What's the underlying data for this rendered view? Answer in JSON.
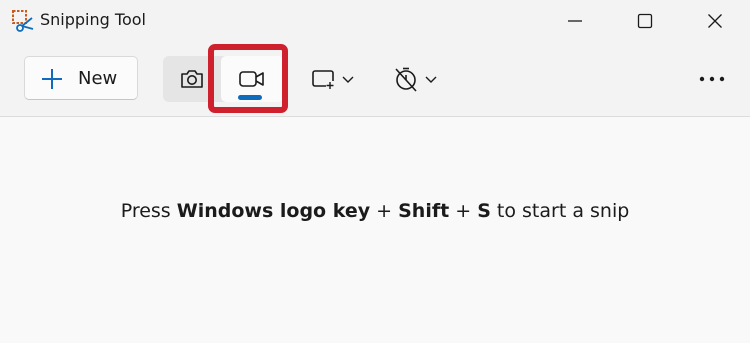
{
  "window": {
    "title": "Snipping Tool",
    "app_icon": "snipping-tool-icon",
    "controls": {
      "minimize_icon": "minimize-icon",
      "maximize_icon": "maximize-icon",
      "close_icon": "close-icon"
    }
  },
  "toolbar": {
    "new_label": "New",
    "new_icon": "plus-icon",
    "modes": [
      {
        "icon": "camera-icon",
        "selected": false
      },
      {
        "icon": "video-camera-icon",
        "selected": true
      }
    ],
    "shape_dropdown_icon": "rectangle-snip-icon",
    "timer_dropdown_icon": "no-delay-timer-icon",
    "more_icon": "more-options-icon"
  },
  "content": {
    "hint_prefix": "Press ",
    "hint_key1": "Windows logo key",
    "hint_plus1": " + ",
    "hint_key2": "Shift",
    "hint_plus2": " + ",
    "hint_key3": "S",
    "hint_suffix": " to start a snip"
  },
  "colors": {
    "accent": "#0f6cbd",
    "highlight_box": "#cf202e",
    "icon_orange": "#c85a1e"
  }
}
